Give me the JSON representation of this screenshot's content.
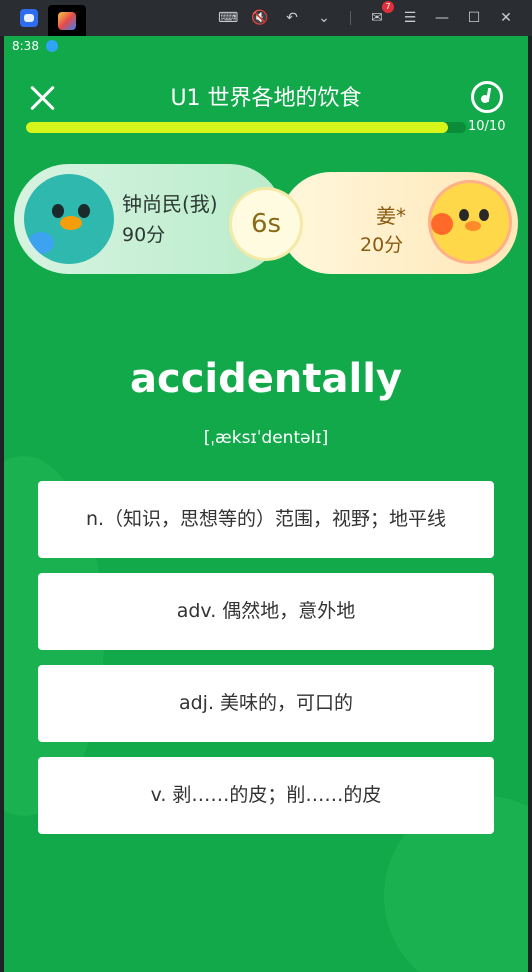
{
  "emulator": {
    "mail_count": "7",
    "icons": [
      "keyboard-icon",
      "mute-icon",
      "undo-icon",
      "chevron-down-icon",
      "mail-icon",
      "menu-icon",
      "minimize-icon",
      "maximize-icon",
      "close-window-icon"
    ]
  },
  "status_bar": {
    "time": "8:38"
  },
  "header": {
    "title": "U1 世界各地的饮食",
    "progress_text": "10/10",
    "progress_fraction": 0.96
  },
  "battle": {
    "player": {
      "name": "钟尚民(我)",
      "score": "90分"
    },
    "opponent": {
      "name": "姜*",
      "score": "20分"
    },
    "timer": "6s"
  },
  "question": {
    "word": "accidentally",
    "phonetic": "[ˌæksɪˈdentəlɪ]",
    "options": [
      "n.（知识，思想等的）范围，视野；地平线",
      "adv. 偶然地，意外地",
      "adj. 美味的，可口的",
      "v. 剥……的皮；削……的皮"
    ]
  },
  "colors": {
    "background": "#11a94a",
    "progress_fill": "#d6f51b"
  }
}
